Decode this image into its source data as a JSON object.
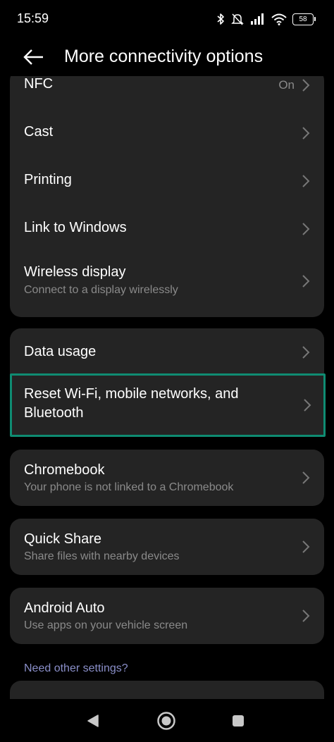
{
  "status_bar": {
    "time": "15:59",
    "battery": "58",
    "icons": [
      "bluetooth-icon",
      "mute-icon",
      "signal-icon",
      "wifi-icon",
      "battery-icon"
    ]
  },
  "header": {
    "title": "More connectivity options",
    "back_icon": "arrow-left-icon"
  },
  "groups": {
    "main": [
      {
        "title": "NFC",
        "value": "On"
      },
      {
        "title": "Cast"
      },
      {
        "title": "Printing"
      },
      {
        "title": "Link to Windows"
      },
      {
        "title": "Wireless display",
        "subtitle": "Connect to a display wirelessly"
      }
    ],
    "data_usage": {
      "title": "Data usage"
    },
    "reset": {
      "title_line1": "Reset Wi-Fi, mobile networks, and",
      "title_line2": "Bluetooth"
    },
    "chromebook": {
      "title": "Chromebook",
      "subtitle": "Your phone is not linked to a Chromebook"
    },
    "quick_share": {
      "title": "Quick Share",
      "subtitle": "Share files with nearby devices"
    },
    "android_auto": {
      "title": "Android Auto",
      "subtitle": "Use apps on your vehicle screen"
    }
  },
  "footer": {
    "need_settings": "Need other settings?"
  },
  "colors": {
    "background": "#000000",
    "card": "#242424",
    "highlight": "#0f8c72",
    "subtitle": "#8a8a8a",
    "link": "#8a8fc9"
  },
  "nav": {
    "icons": [
      "back-triangle-icon",
      "home-circle-icon",
      "recents-square-icon"
    ]
  }
}
